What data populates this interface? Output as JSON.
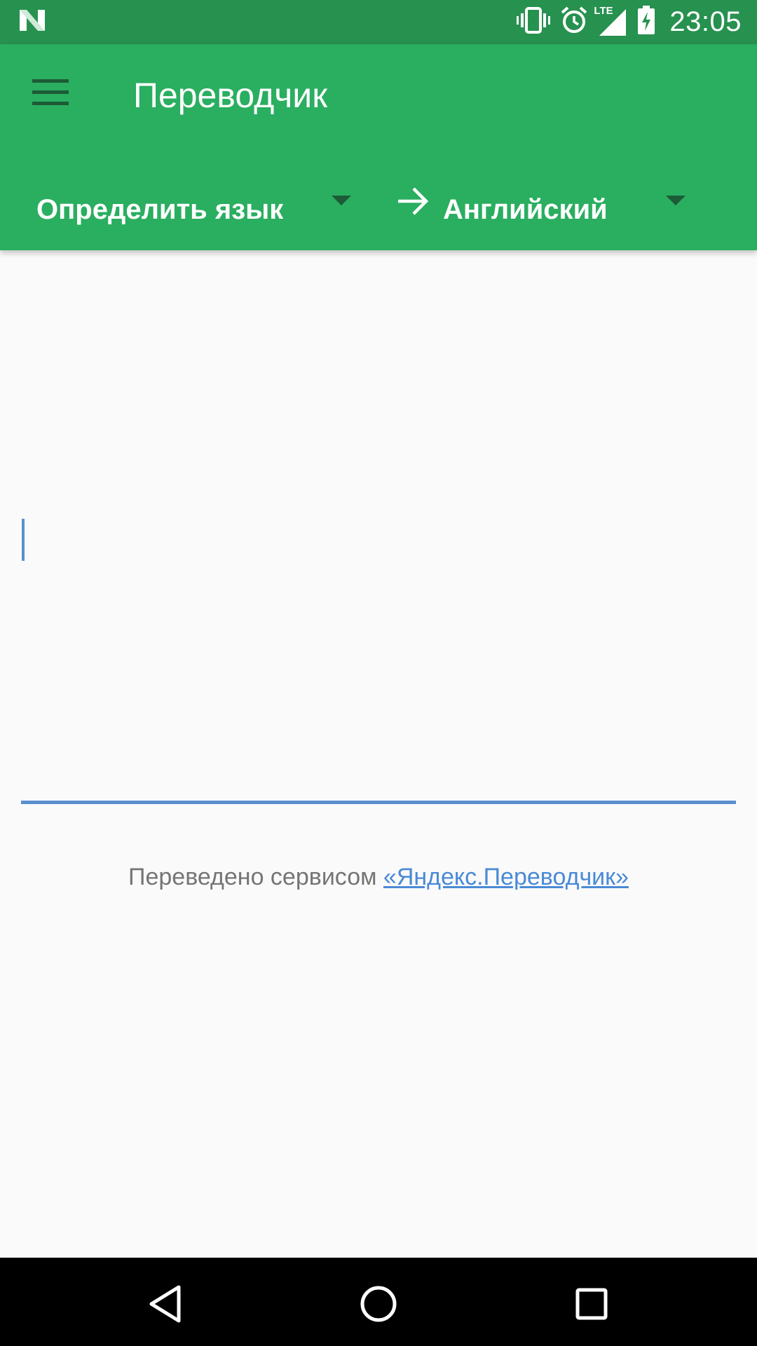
{
  "status_bar": {
    "time": "23:05",
    "network_label": "LTE",
    "icons": [
      "notification-n-icon",
      "vibrate-icon",
      "alarm-icon",
      "signal-lte-icon",
      "battery-charging-icon"
    ]
  },
  "app_bar": {
    "title": "Переводчик",
    "menu_icon": "hamburger-menu-icon",
    "source_language": "Определить язык",
    "target_language": "Английский",
    "direction_icon": "arrow-right-icon"
  },
  "input": {
    "value": ""
  },
  "attribution": {
    "prefix": "Переведено сервисом ",
    "link_text": "«Яндекс.Переводчик»"
  },
  "colors": {
    "status_bar": "#27914f",
    "app_bar": "#2aae60",
    "accent": "#5b8fd0",
    "link": "#4a8ad6",
    "background": "#fafafa"
  },
  "nav_bar": {
    "icons": [
      "back-icon",
      "home-icon",
      "recents-icon"
    ]
  }
}
